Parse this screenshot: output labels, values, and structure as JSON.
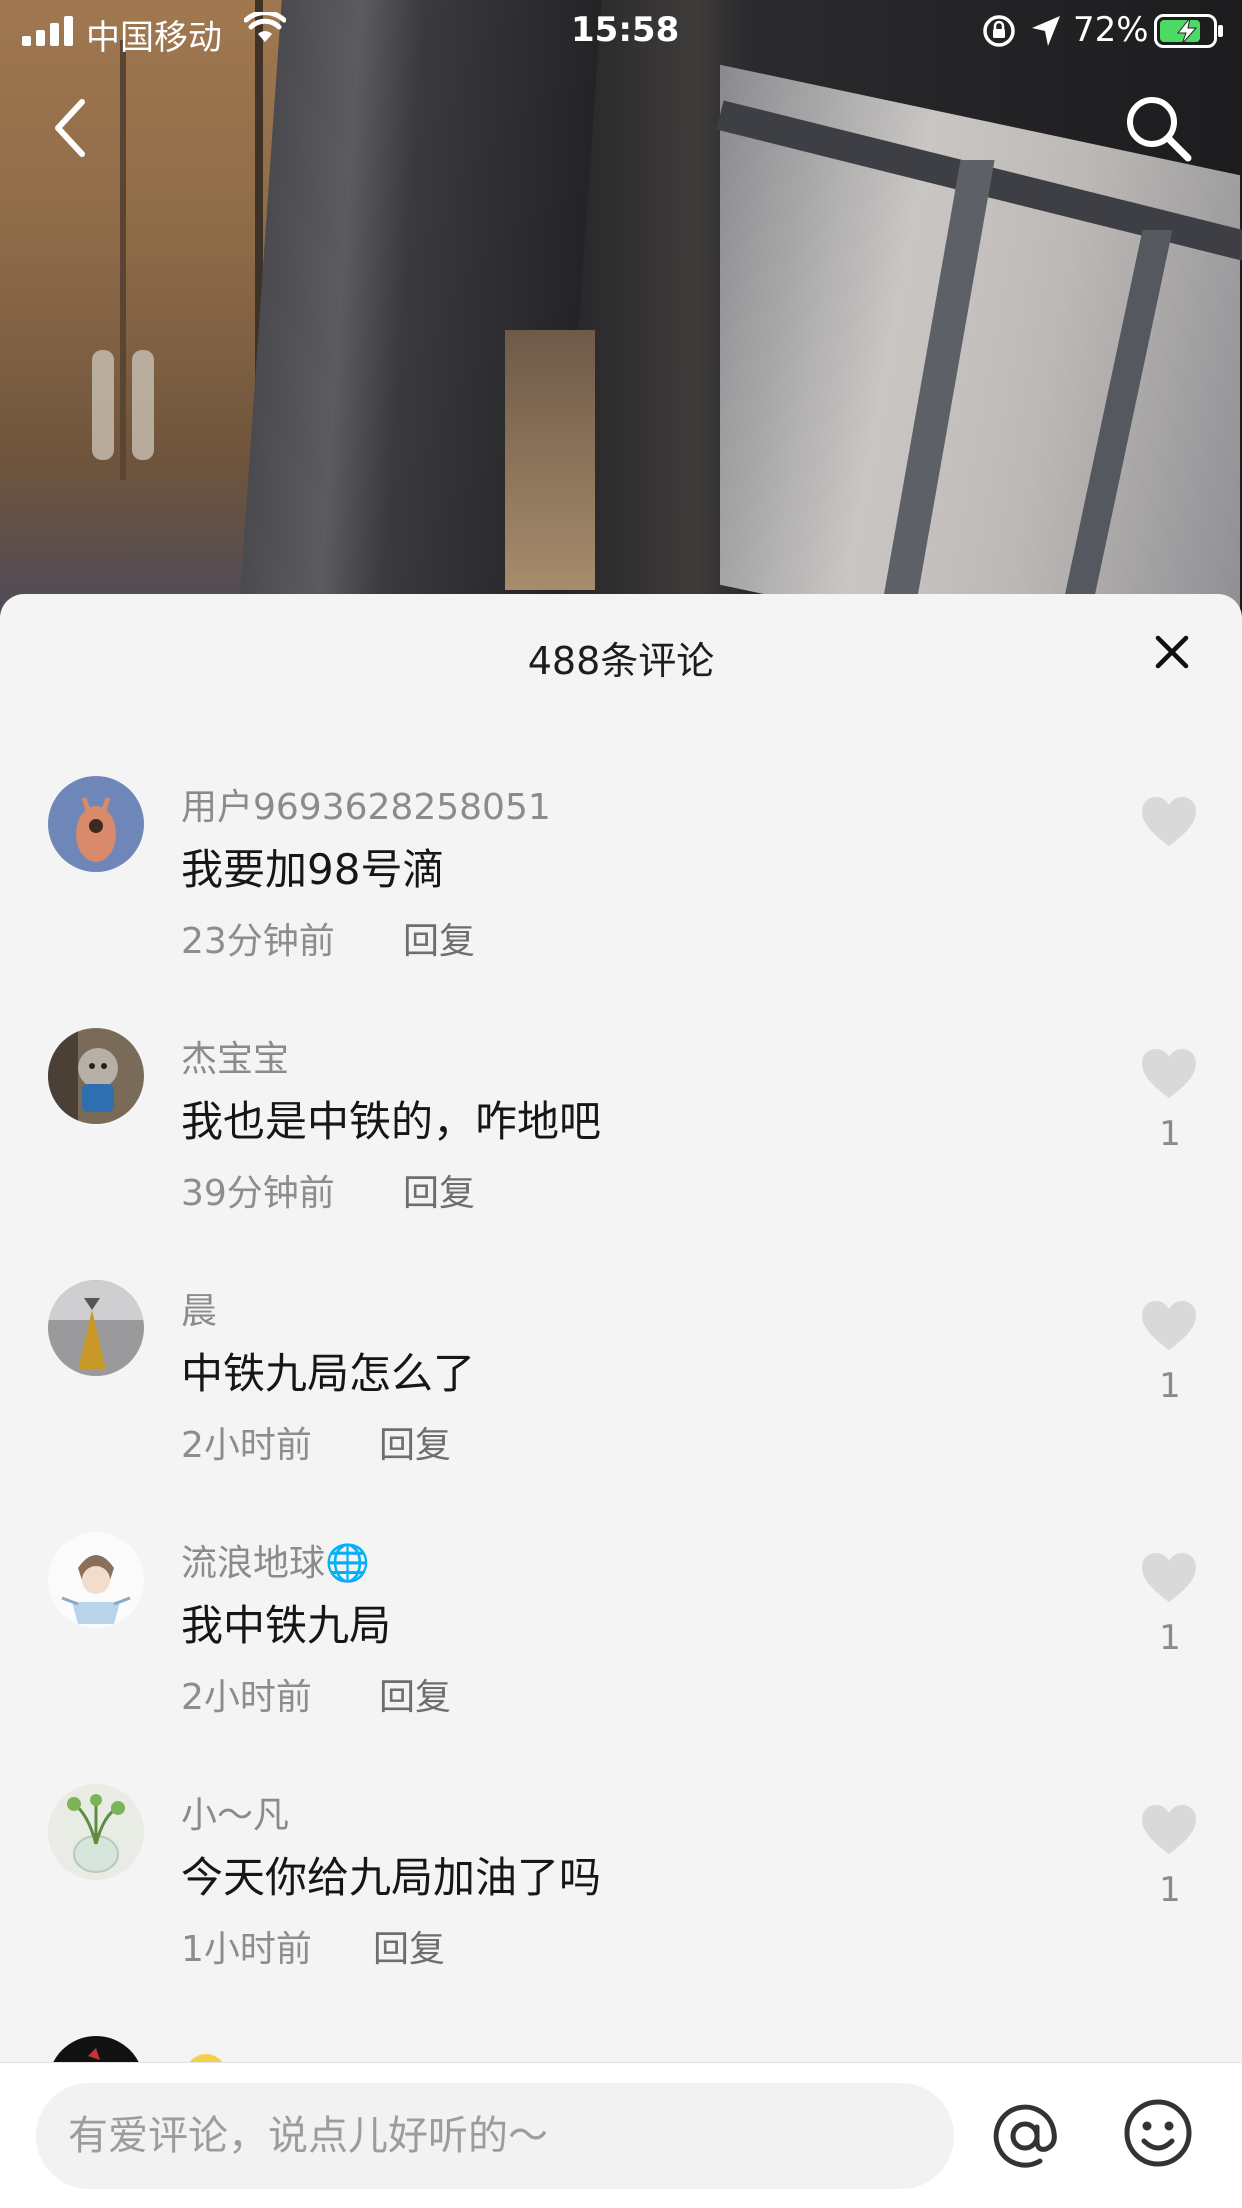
{
  "status_bar": {
    "carrier": "中国移动",
    "time": "15:58",
    "battery": "72%"
  },
  "icons": {
    "back": "back-arrow-icon",
    "search": "search-icon",
    "close": "close-icon",
    "like": "heart-icon",
    "mention": "at-icon",
    "emoji": "smiley-icon"
  },
  "colors": {
    "sheet_bg": "#f4f4f4",
    "username": "#8b8b8b",
    "like_heart": "#d9d9d9"
  },
  "sheet": {
    "title": "488条评论"
  },
  "comments": [
    {
      "user": "用户9693628258051",
      "text": "我要加98号滴",
      "time": "23分钟前",
      "reply": "回复",
      "likes": ""
    },
    {
      "user": "杰宝宝",
      "text": "我也是中铁的，咋地吧",
      "time": "39分钟前",
      "reply": "回复",
      "likes": "1"
    },
    {
      "user": "晨",
      "text": "中铁九局怎么了",
      "time": "2小时前",
      "reply": "回复",
      "likes": "1"
    },
    {
      "user": "流浪地球🌐",
      "text": "我中铁九局",
      "time": "2小时前",
      "reply": "回复",
      "likes": "1"
    },
    {
      "user": "小～凡",
      "text": "今天你给九局加油了吗",
      "time": "1小时前",
      "reply": "回复",
      "likes": "1"
    }
  ],
  "input": {
    "placeholder": "有爱评论，说点儿好听的～"
  }
}
